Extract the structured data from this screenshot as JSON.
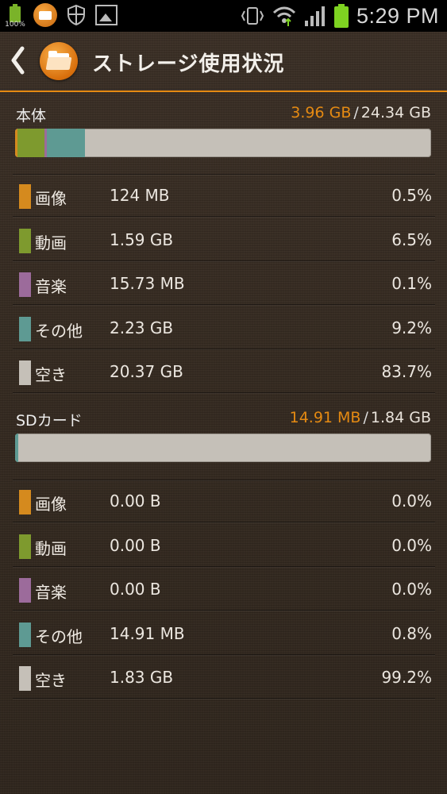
{
  "status_bar": {
    "battery_small_label": "100%",
    "time": "5:29 PM",
    "icons": [
      "battery-full-icon",
      "app-notification-icon",
      "shield-icon",
      "image-icon",
      "vibrate-icon",
      "wifi-icon",
      "signal-icon",
      "battery-icon"
    ]
  },
  "header": {
    "title": "ストレージ使用状況",
    "back_icon": "chevron-left-icon",
    "app_icon": "folder-app-icon"
  },
  "colors": {
    "accent": "#e58a12",
    "images": "#d58a1e",
    "videos": "#7e9a2e",
    "music": "#9c6b9b",
    "other": "#5e9a93",
    "free": "#c5c0b8"
  },
  "internal": {
    "label": "本体",
    "used": "3.96 GB",
    "total": "24.34 GB",
    "bar_fractions": {
      "images": 0.005,
      "videos": 0.065,
      "music": 0.001,
      "other": 0.092
    },
    "rows": [
      {
        "label": "画像",
        "size": "124 MB",
        "pct": "0.5%",
        "key": "images"
      },
      {
        "label": "動画",
        "size": "1.59 GB",
        "pct": "6.5%",
        "key": "videos"
      },
      {
        "label": "音楽",
        "size": "15.73 MB",
        "pct": "0.1%",
        "key": "music"
      },
      {
        "label": "その他",
        "size": "2.23 GB",
        "pct": "9.2%",
        "key": "other"
      },
      {
        "label": "空き",
        "size": "20.37 GB",
        "pct": "83.7%",
        "key": "free"
      }
    ]
  },
  "sdcard": {
    "label": "SDカード",
    "used": "14.91 MB",
    "total": "1.84 GB",
    "bar_fractions": {
      "images": 0.0,
      "videos": 0.0,
      "music": 0.0,
      "other": 0.008
    },
    "rows": [
      {
        "label": "画像",
        "size": "0.00 B",
        "pct": "0.0%",
        "key": "images"
      },
      {
        "label": "動画",
        "size": "0.00 B",
        "pct": "0.0%",
        "key": "videos"
      },
      {
        "label": "音楽",
        "size": "0.00 B",
        "pct": "0.0%",
        "key": "music"
      },
      {
        "label": "その他",
        "size": "14.91 MB",
        "pct": "0.8%",
        "key": "other"
      },
      {
        "label": "空き",
        "size": "1.83 GB",
        "pct": "99.2%",
        "key": "free"
      }
    ]
  }
}
